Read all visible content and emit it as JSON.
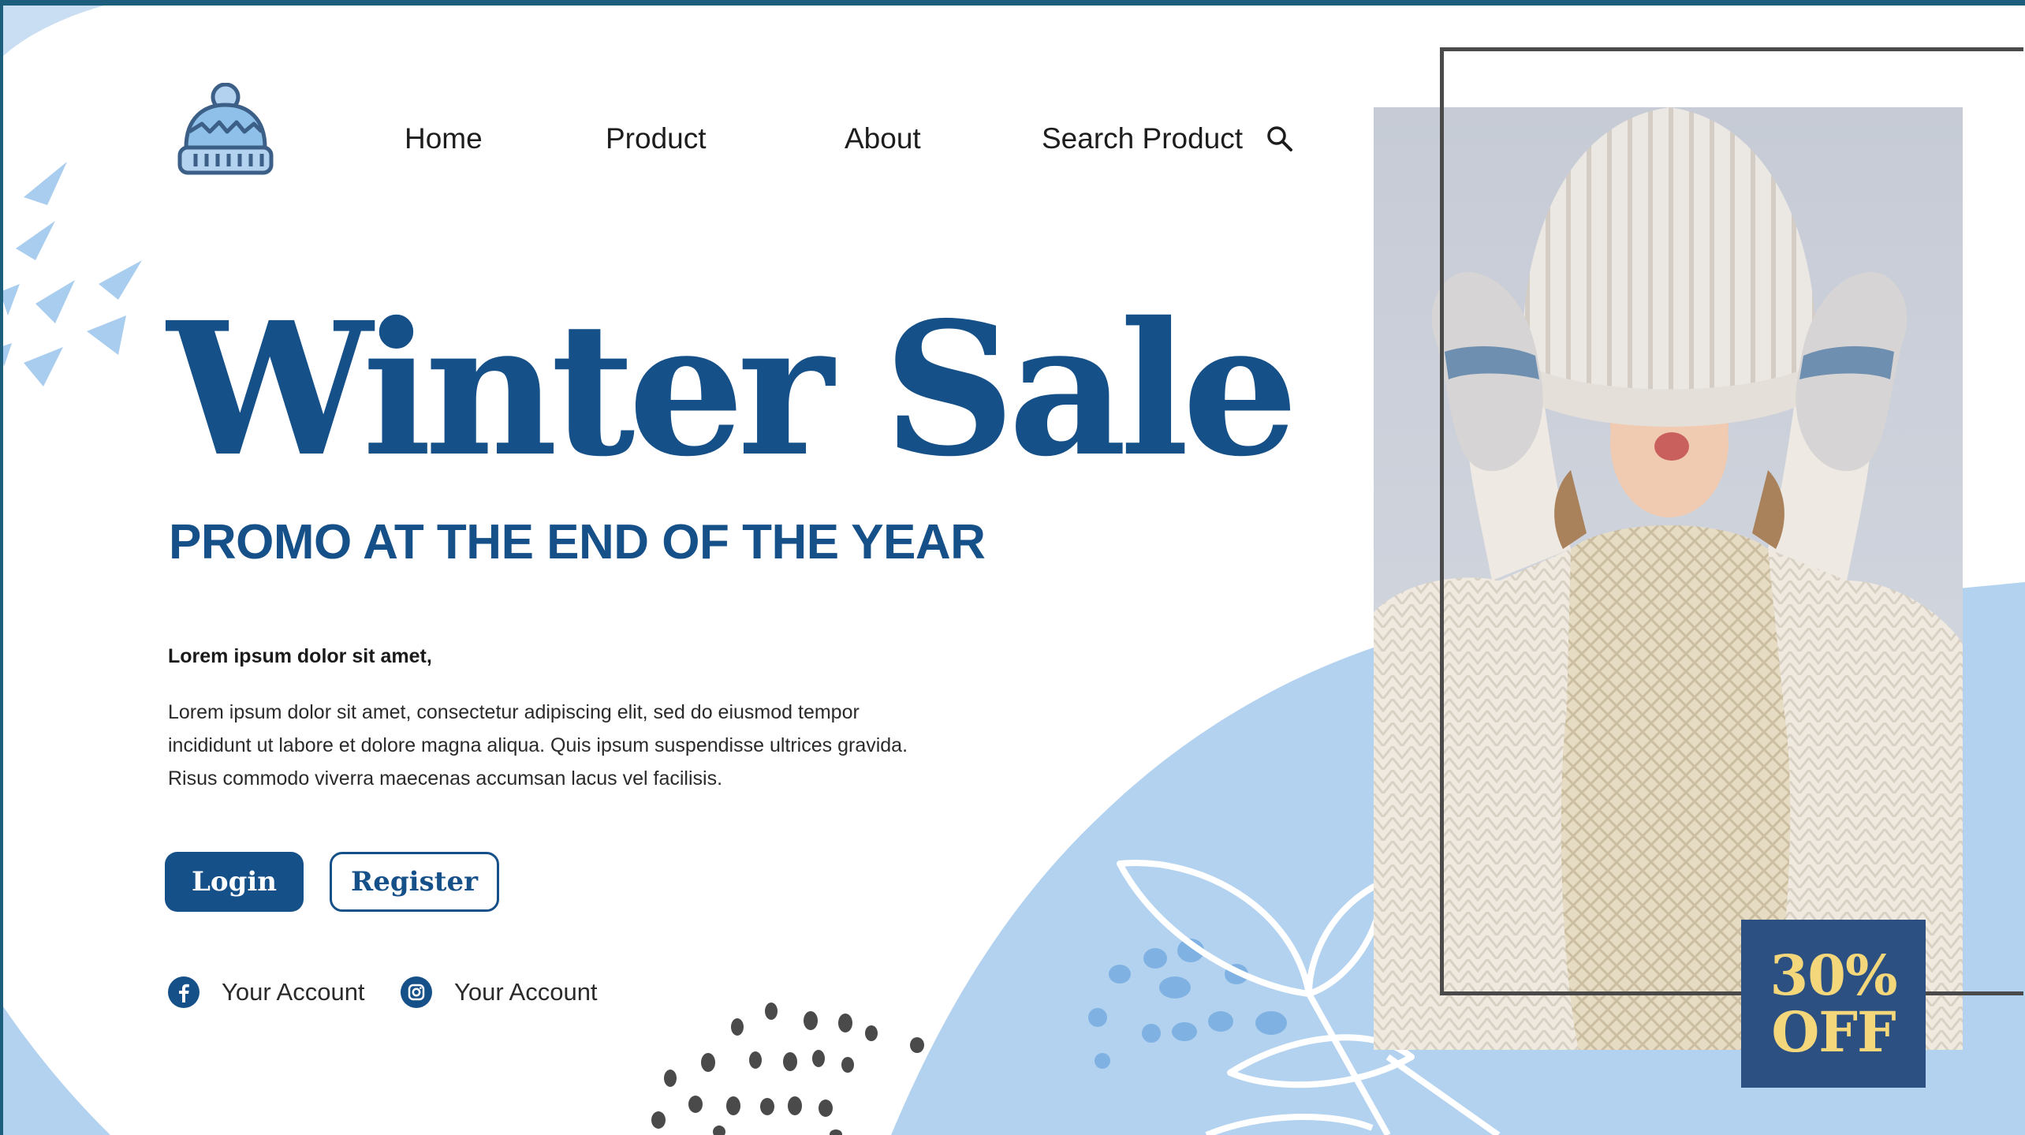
{
  "brand": {
    "logo_icon": "beanie-hat-icon",
    "accent": "#165089",
    "light_blue": "#b3d2f0",
    "frame_color": "#4a4a4a",
    "badge_bg": "#2c5082",
    "badge_text_color": "#f3d77a"
  },
  "nav": {
    "items": [
      "Home",
      "Product",
      "About",
      "Search Product"
    ],
    "search_icon": "search-icon"
  },
  "hero": {
    "title": "Winter Sale",
    "subtitle": "PROMO AT THE END OF THE YEAR",
    "lead": "Lorem ipsum dolor sit amet,",
    "body": "Lorem ipsum dolor sit amet, consectetur adipiscing elit, sed do eiusmod tempor incididunt ut labore et dolore magna aliqua. Quis ipsum suspendisse ultrices gravida. Risus commodo viverra maecenas accumsan lacus vel facilisis."
  },
  "buttons": {
    "login": "Login",
    "register": "Register"
  },
  "social": [
    {
      "icon": "facebook-icon",
      "label": "Your Account"
    },
    {
      "icon": "instagram-icon",
      "label": "Your Account"
    }
  ],
  "badge": {
    "line1": "30%",
    "line2": "OFF"
  }
}
